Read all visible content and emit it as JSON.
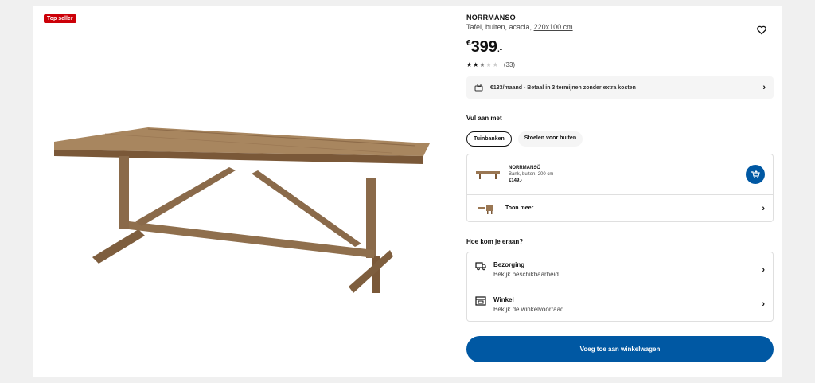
{
  "badge": "Top seller",
  "product": {
    "name": "NORRMANSÖ",
    "desc_prefix": "Tafel, buiten, acacia, ",
    "desc_size": "220x100 cm",
    "currency": "€",
    "price_int": "399",
    "price_dec": ".-",
    "rating_stars": 2.5,
    "rating_count": "(33)"
  },
  "payment": {
    "text": "€133/maand - Betaal in 3 termijnen zonder extra kosten"
  },
  "complete": {
    "title": "Vul aan met",
    "pills": [
      "Tuinbanken",
      "Stoelen voor buiten"
    ],
    "rec": {
      "name": "NORRMANSÖ",
      "desc": "Bank, buiten, 200 cm",
      "price": "€149.-"
    },
    "more": "Toon meer"
  },
  "delivery": {
    "title": "Hoe kom je eraan?",
    "options": [
      {
        "title": "Bezorging",
        "sub": "Bekijk beschikbaarheid",
        "icon": "truck-icon"
      },
      {
        "title": "Winkel",
        "sub": "Bekijk de winkelvoorraad",
        "icon": "store-icon"
      }
    ]
  },
  "cta": "Voeg toe aan winkelwagen",
  "colors": {
    "brand_blue": "#0058a3",
    "badge_red": "#cc0008",
    "wood": "#8a6a4a"
  }
}
